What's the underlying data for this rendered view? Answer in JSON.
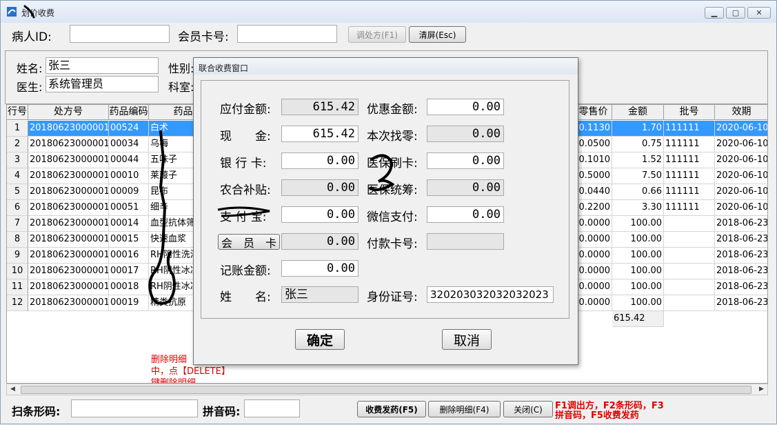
{
  "window": {
    "title": "划价收费"
  },
  "top": {
    "patient_id_label": "病人ID:",
    "patient_id_value": "",
    "member_card_label": "会员卡号:",
    "member_card_value": "",
    "recall_btn": "调处方(F1)",
    "clear_btn": "清屏(Esc)"
  },
  "info": {
    "name_label": "姓名:",
    "name_value": "张三",
    "gender_label": "性别:",
    "doctor_label": "医生:",
    "doctor_value": "系统管理员",
    "dept_label": "科室:"
  },
  "grid": {
    "headers": [
      "行号",
      "处方号",
      "药品编码",
      "药品",
      "零售价",
      "金额",
      "批号",
      "效期"
    ],
    "rows": [
      {
        "no": "1",
        "rx": "20180623000001",
        "code": "00524",
        "drug": "白术",
        "price": "0.1130",
        "amount": "1.70",
        "batch": "111111",
        "exp": "2020-06-10"
      },
      {
        "no": "2",
        "rx": "20180623000001",
        "code": "00034",
        "drug": "乌梅",
        "price": "0.0500",
        "amount": "0.75",
        "batch": "111111",
        "exp": "2020-06-10"
      },
      {
        "no": "3",
        "rx": "20180623000001",
        "code": "00044",
        "drug": "五味子",
        "price": "0.1010",
        "amount": "1.52",
        "batch": "111111",
        "exp": "2020-06-10"
      },
      {
        "no": "4",
        "rx": "20180623000001",
        "code": "00010",
        "drug": "莱菔子",
        "price": "0.5000",
        "amount": "7.50",
        "batch": "111111",
        "exp": "2020-06-10"
      },
      {
        "no": "5",
        "rx": "20180623000001",
        "code": "00009",
        "drug": "昆布",
        "price": "0.0440",
        "amount": "0.66",
        "batch": "111111",
        "exp": "2020-06-10"
      },
      {
        "no": "6",
        "rx": "20180623000001",
        "code": "00051",
        "drug": "细辛",
        "price": "0.2200",
        "amount": "3.30",
        "batch": "111111",
        "exp": "2020-06-10"
      },
      {
        "no": "7",
        "rx": "20180623000001",
        "code": "00014",
        "drug": "血型抗体筛",
        "price": "0.0000",
        "amount": "100.00",
        "batch": "",
        "exp": "2018-06-23"
      },
      {
        "no": "8",
        "rx": "20180623000001",
        "code": "00015",
        "drug": "快速血浆",
        "price": "0.0000",
        "amount": "100.00",
        "batch": "",
        "exp": "2018-06-23"
      },
      {
        "no": "9",
        "rx": "20180623000001",
        "code": "00016",
        "drug": "RH阴性洗涤",
        "price": "0.0000",
        "amount": "100.00",
        "batch": "",
        "exp": "2018-06-23"
      },
      {
        "no": "10",
        "rx": "20180623000001",
        "code": "00017",
        "drug": "RH阴性冰冻",
        "price": "0.0000",
        "amount": "100.00",
        "batch": "",
        "exp": "2018-06-23"
      },
      {
        "no": "11",
        "rx": "20180623000001",
        "code": "00018",
        "drug": "RH阴性冰冻",
        "price": "0.0000",
        "amount": "100.00",
        "batch": "",
        "exp": "2018-06-23"
      },
      {
        "no": "12",
        "rx": "20180623000001",
        "code": "00019",
        "drug": "精类抗原",
        "price": "0.0000",
        "amount": "100.00",
        "batch": "",
        "exp": "2018-06-23"
      }
    ],
    "total": "615.42",
    "hint_lines": [
      "删除明细",
      "中，点【DELETE】",
      "键删除明细"
    ]
  },
  "dialog": {
    "title": "联合收费窗口",
    "payable_label": "应付金额:",
    "payable": "615.42",
    "discount_label": "优惠金额:",
    "discount": "0.00",
    "cash_label": "现　　金:",
    "cash": "615.42",
    "change_label": "本次找零:",
    "change": "0.00",
    "bank_label": "银 行 卡:",
    "bank": "0.00",
    "medcard_label": "医保刷卡:",
    "medcard": "0.00",
    "rural_label": "农合补贴:",
    "rural": "0.00",
    "medpool_label": "医保统筹:",
    "medpool": "0.00",
    "alipay_label": "支 付 宝:",
    "alipay": "0.00",
    "wechat_label": "微信支付:",
    "wechat": "0.00",
    "member_btn": "会　员　卡",
    "member": "0.00",
    "paycard_label": "付款卡号:",
    "paycard": "",
    "account_label": "记账金额:",
    "account": "0.00",
    "name_label": "姓　　名:",
    "name": "张三",
    "idcard_label": "身份证号:",
    "idcard": "320203032032032023",
    "ok_btn": "确定",
    "cancel_btn": "取消"
  },
  "footer": {
    "barcode_label": "扫条形码:",
    "barcode_value": "",
    "pinyin_label": "拼音码:",
    "pinyin_value": "",
    "charge_btn": "收费发药(F5)",
    "delete_btn": "删除明细(F4)",
    "close_btn": "关闭(C)",
    "shortcut_hint_1": "F1调出方，F2条形码，F3",
    "shortcut_hint_2": "拼音码，F5收费发药"
  }
}
